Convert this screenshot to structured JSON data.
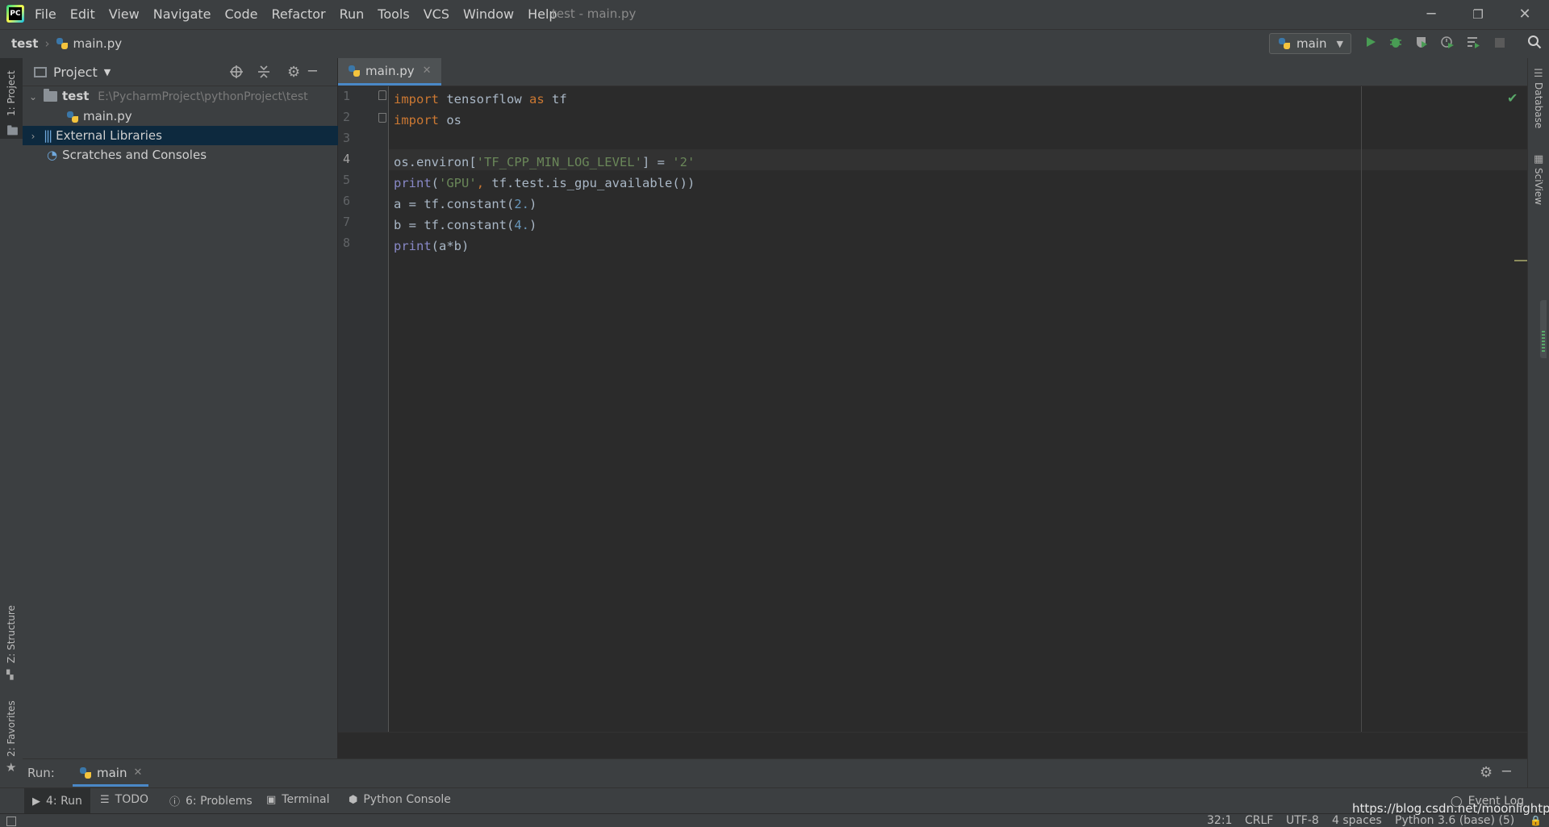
{
  "window": {
    "logo": "PC",
    "menu": [
      "File",
      "Edit",
      "View",
      "Navigate",
      "Code",
      "Refactor",
      "Run",
      "Tools",
      "VCS",
      "Window",
      "Help"
    ],
    "title": "test - main.py",
    "controls": {
      "minimize": "─",
      "restore": "❐",
      "close": "✕"
    }
  },
  "navbar": {
    "breadcrumb": [
      "test",
      "main.py"
    ],
    "run_config": "main",
    "icons": [
      "run-icon",
      "debug-icon",
      "coverage-icon",
      "profile-icon",
      "concurrency-icon",
      "stop-icon",
      "search-icon"
    ]
  },
  "left_strip": {
    "top": "1: Project",
    "structure": "Z: Structure",
    "favorites": "2: Favorites"
  },
  "right_strip": {
    "database": "Database",
    "sciview": "SciView"
  },
  "project": {
    "title": "Project",
    "tree": [
      {
        "label": "test",
        "path": "E:\\PycharmProject\\pythonProject\\test"
      },
      {
        "label": "main.py"
      },
      {
        "label": "External Libraries"
      },
      {
        "label": "Scratches and Consoles"
      }
    ]
  },
  "editor": {
    "tab": "main.py",
    "line_numbers": [
      "1",
      "2",
      "3",
      "4",
      "5",
      "6",
      "7",
      "8"
    ],
    "current_line": 4,
    "code": [
      [
        {
          "t": "import",
          "c": "kw"
        },
        {
          "t": " tensorflow "
        },
        {
          "t": "as",
          "c": "kw"
        },
        {
          "t": " tf"
        }
      ],
      [
        {
          "t": "import",
          "c": "kw"
        },
        {
          "t": " os"
        }
      ],
      [],
      [
        {
          "t": "os.environ["
        },
        {
          "t": "'TF_CPP_MIN_LOG_LEVEL'",
          "c": "str"
        },
        {
          "t": "] = "
        },
        {
          "t": "'2'",
          "c": "str"
        }
      ],
      [
        {
          "t": "print",
          "c": "bi"
        },
        {
          "t": "("
        },
        {
          "t": "'GPU'",
          "c": "str"
        },
        {
          "t": ", ",
          "c": "kw"
        },
        {
          "t": "tf.test.is_gpu_available())"
        }
      ],
      [
        {
          "t": "a = tf.constant("
        },
        {
          "t": "2.",
          "c": "num"
        },
        {
          "t": ")"
        }
      ],
      [
        {
          "t": "b = tf.constant("
        },
        {
          "t": "4.",
          "c": "num"
        },
        {
          "t": ")"
        }
      ],
      [
        {
          "t": "print",
          "c": "bi"
        },
        {
          "t": "(a*b)"
        }
      ]
    ]
  },
  "run_panel": {
    "label": "Run:",
    "tab": "main"
  },
  "tool_tabs": [
    {
      "label": "4: Run",
      "icon": "▶"
    },
    {
      "label": "TODO",
      "icon": "☰"
    },
    {
      "label": "6: Problems",
      "icon": "ⓘ"
    },
    {
      "label": "Terminal",
      "icon": "▣"
    },
    {
      "label": "Python Console",
      "icon": "⬢"
    }
  ],
  "event_log": "Event Log",
  "status": {
    "position": "32:1",
    "line_sep": "CRLF",
    "encoding": "UTF-8",
    "indent": "4 spaces",
    "interpreter": "Python 3.6 (base) (5)"
  },
  "watermark": "https://blog.csdn.net/moonlightpp",
  "colors": {
    "accent": "#4a88c7",
    "run_green": "#499c54",
    "check_green": "#59a869"
  }
}
